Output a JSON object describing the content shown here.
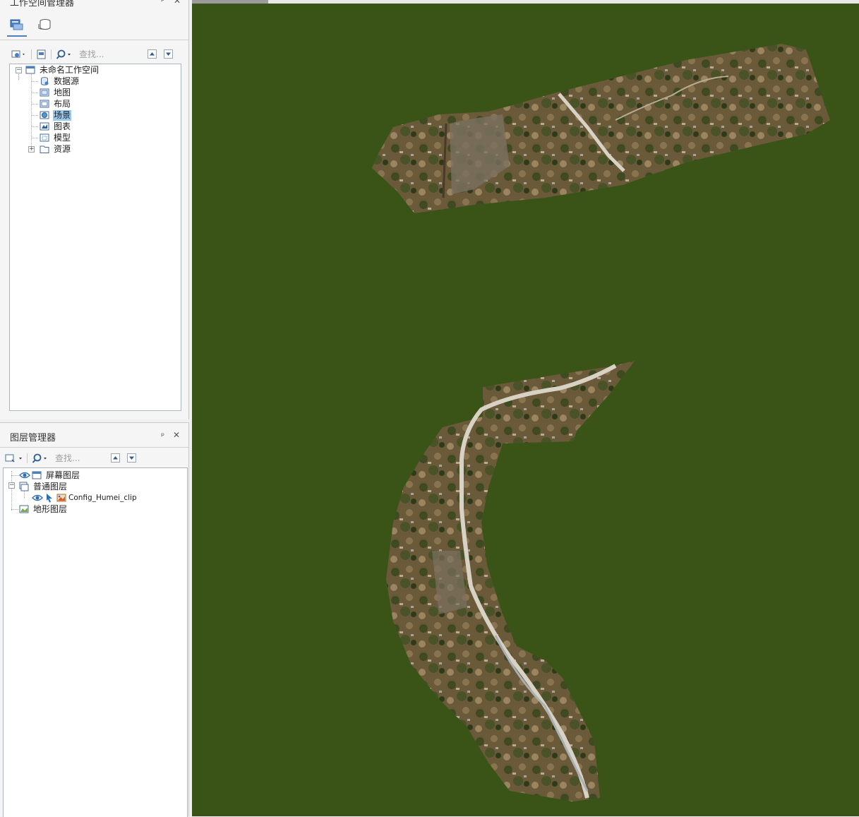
{
  "workspace_manager": {
    "title": "工作空间管理器",
    "search_placeholder": "查找...",
    "tabs": [
      "workspace-tab-icon",
      "datasource-tab-icon"
    ],
    "tree": {
      "root": "未命名工作空间",
      "items": [
        {
          "label": "数据源",
          "icon": "datasource-icon"
        },
        {
          "label": "地图",
          "icon": "map-icon"
        },
        {
          "label": "布局",
          "icon": "layout-icon"
        },
        {
          "label": "场景",
          "icon": "scene-icon",
          "selected": true
        },
        {
          "label": "图表",
          "icon": "chart-icon"
        },
        {
          "label": "模型",
          "icon": "model-icon"
        },
        {
          "label": "资源",
          "icon": "resource-icon",
          "expandable": true
        }
      ]
    }
  },
  "layer_manager": {
    "title": "图层管理器",
    "search_placeholder": "查找...",
    "tree": {
      "screen_layer": "屏幕图层",
      "normal_layer": "普通图层",
      "config_layer": "Config_Humei_clip",
      "terrain_layer": "地形图层"
    }
  },
  "scene": {
    "background_color": "#3a5418",
    "imagery_color": "#6b5a3a",
    "road_color": "#d8d2c4"
  }
}
